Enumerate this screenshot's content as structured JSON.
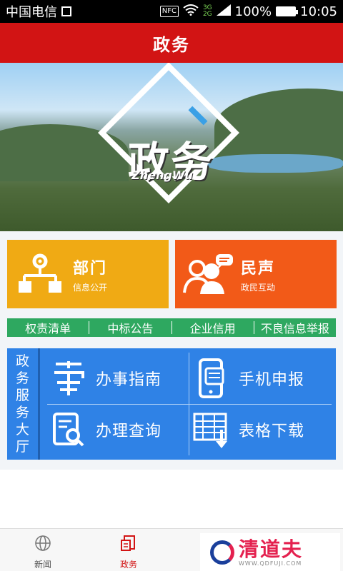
{
  "status_bar": {
    "carrier": "中国电信",
    "nfc": "NFC",
    "network_top": "3G",
    "network_bottom": "2G",
    "battery": "100%",
    "battery_level": 1.0,
    "time": "10:05"
  },
  "header": {
    "title": "政务"
  },
  "banner": {
    "title": "政务",
    "subtitle": "ZhengWu"
  },
  "tiles": [
    {
      "title": "部门",
      "subtitle": "信息公开",
      "color": "#f0aa14",
      "icon": "org-chart-icon"
    },
    {
      "title": "民声",
      "subtitle": "政民互动",
      "color": "#f25a18",
      "icon": "people-chat-icon"
    }
  ],
  "quick_links": [
    "权责清单",
    "中标公告",
    "企业信用",
    "不良信息举报"
  ],
  "service_hall": {
    "label_chars": [
      "政",
      "务",
      "服",
      "务",
      "大",
      "厅"
    ],
    "items": [
      {
        "label": "办事指南",
        "icon": "guide-icon"
      },
      {
        "label": "手机申报",
        "icon": "mobile-report-icon"
      },
      {
        "label": "办理查询",
        "icon": "search-doc-icon"
      },
      {
        "label": "表格下载",
        "icon": "form-download-icon"
      }
    ]
  },
  "bottom_nav": {
    "items": [
      {
        "label": "新闻",
        "icon": "globe-icon",
        "active": false
      },
      {
        "label": "政务",
        "icon": "document-icon",
        "active": true
      }
    ]
  },
  "watermark": {
    "title": "清道夫",
    "url": "WWW.QDFUJI.COM"
  },
  "colors": {
    "header": "#d21414",
    "quick_links": "#2ea860",
    "service_hall": "#2f82e6"
  }
}
